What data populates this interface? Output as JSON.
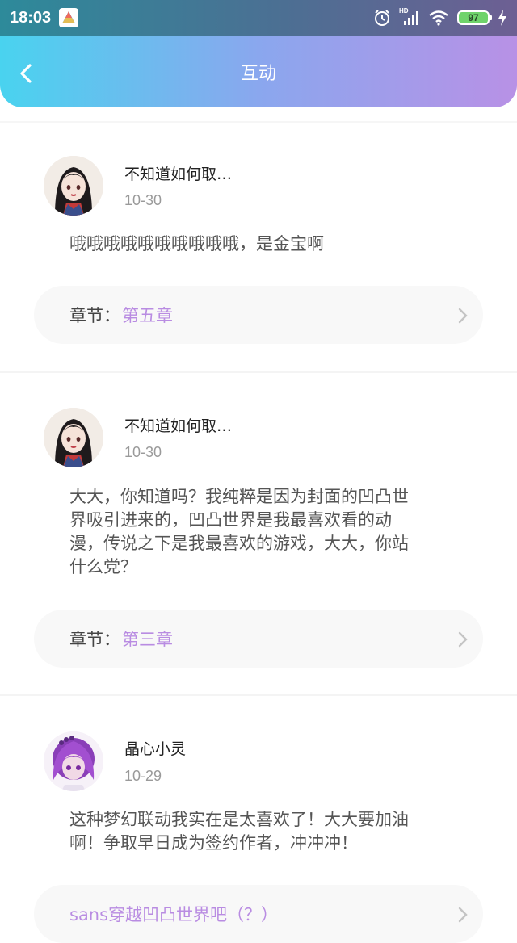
{
  "status_bar": {
    "time": "18:03",
    "battery": "97",
    "network_label": "HD"
  },
  "header": {
    "title": "互动"
  },
  "comments": [
    {
      "username": "不知道如何取…",
      "date": "10-30",
      "body": "哦哦哦哦哦哦哦哦哦哦，是金宝啊",
      "chapter_label": "章节：",
      "chapter_value": "第五章"
    },
    {
      "username": "不知道如何取…",
      "date": "10-30",
      "body_lines": [
        "大大，你知道吗？我纯粹是因为封面的凹凸世",
        "界吸引进来的，凹凸世界是我最喜欢看的动",
        "漫，传说之下是我最喜欢的游戏，大大，你站",
        "什么党？"
      ],
      "chapter_label": "章节：",
      "chapter_value": "第三章"
    },
    {
      "username": "晶心小灵",
      "date": "10-29",
      "body_lines": [
        "这种梦幻联动我实在是太喜欢了！大大要加油",
        "啊！争取早日成为签约作者，冲冲冲！"
      ],
      "chapter_value": "sans穿越凹凸世界吧（？）"
    }
  ],
  "colors": {
    "header_start": "#49d3ef",
    "header_end": "#b891e6",
    "chapter_accent": "#b98ce2"
  }
}
